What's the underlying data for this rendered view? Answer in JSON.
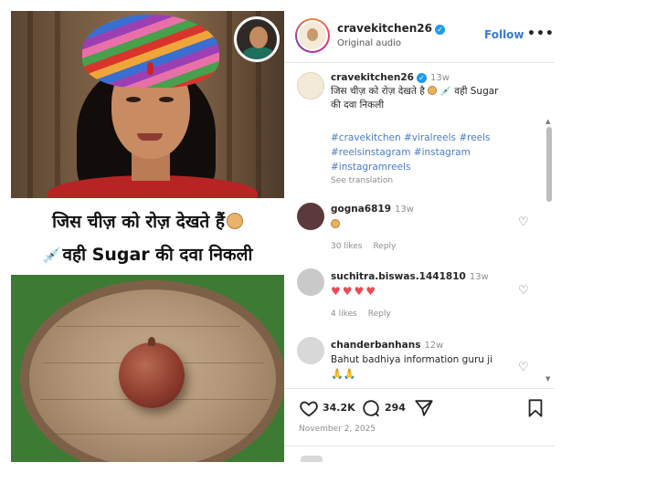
{
  "media": {
    "caption_line1": "जिस चीज़ को रोज़ देखते हैं",
    "caption_line2": "वही Sugar की दवा निकली",
    "onion_emoji": "onion-icon",
    "syringe_emoji": "syringe-icon"
  },
  "post": {
    "username": "cravekitchen26",
    "subtitle": "Original audio",
    "follow_label": "Follow",
    "more_label": "•••",
    "caption": {
      "username": "cravekitchen26",
      "time": "13w",
      "text_line1": "जिस चीज़ को रोज़ देखते है",
      "text_line2": "वही Sugar",
      "text_line3": "की दवा निकली",
      "hashtags_line1": "#cravekitchen #viralreels #reels",
      "hashtags_line2": "#reelsinstagram #instagram",
      "hashtags_line3": "#instagramreels",
      "see_translation": "See translation"
    },
    "comments": [
      {
        "username": "gogna6819",
        "time": "13w",
        "likes": "30 likes",
        "reply": "Reply"
      },
      {
        "username": "suchitra.biswas.1441810",
        "time": "13w",
        "hearts": "♥♥♥♥",
        "likes": "4 likes",
        "reply": "Reply"
      },
      {
        "username": "chanderbanhans",
        "time": "12w",
        "text": "Bahut badhiya information guru ji",
        "emoji": "🙏🙏"
      }
    ],
    "actions": {
      "like_count": "34.2K",
      "comment_count": "294"
    },
    "date": "November 2, 2025"
  },
  "colors": {
    "accent_link": "#3a7bd5",
    "hashtag": "#4c7bc9",
    "heart": "#ed4956",
    "verified": "#1d9bf0"
  }
}
